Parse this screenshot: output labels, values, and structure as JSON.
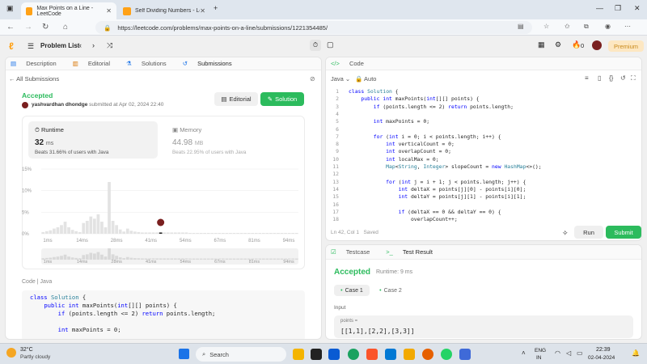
{
  "browser": {
    "tabs": [
      {
        "label": "Max Points on a Line - LeetCode"
      },
      {
        "label": "Self Dividing Numbers - LeetCo"
      }
    ],
    "url": "https://leetcode.com/problems/max-points-on-a-line/submissions/1221354485/"
  },
  "lc_nav": {
    "problem_list": "Problem List",
    "streak": "0",
    "premium": "Premium"
  },
  "left": {
    "tabs": [
      "Description",
      "Editorial",
      "Solutions",
      "Submissions"
    ],
    "all_submissions": "All Submissions",
    "status": "Accepted",
    "author": "yashvardhan dhondge",
    "submitted": "submitted at Apr 02, 2024 22:40",
    "editorial_btn": "Editorial",
    "solution_btn": "Solution",
    "runtime": {
      "label": "Runtime",
      "value": "32",
      "unit": "ms",
      "beats": "Beats 31.66% of users with Java"
    },
    "memory": {
      "label": "Memory",
      "value": "44.98",
      "unit": "MB",
      "beats": "Beats 22.95% of users with Java"
    },
    "code_label": "Code",
    "lang_label": "Java",
    "code_lines": [
      "class Solution {",
      "    public int maxPoints(int[][] points) {",
      "        if (points.length <= 2) return points.length;",
      "",
      "        int maxPoints = 0;"
    ]
  },
  "chart_data": {
    "type": "bar",
    "ylabels": [
      "15%",
      "10%",
      "5%",
      "0%"
    ],
    "xlabels": [
      "1ms",
      "14ms",
      "28ms",
      "41ms",
      "54ms",
      "67ms",
      "81ms",
      "94ms"
    ],
    "mini_xlabels": [
      "1ms",
      "14ms",
      "28ms",
      "41ms",
      "54ms",
      "67ms",
      "81ms",
      "94ms"
    ],
    "values": [
      0.4,
      0.6,
      0.8,
      1.2,
      1.5,
      2.0,
      2.8,
      1.5,
      0.9,
      0.6,
      0.4,
      2.5,
      3.0,
      4.0,
      3.5,
      4.5,
      2.8,
      1.5,
      12.0,
      3.0,
      2.0,
      1.0,
      0.5,
      1.2,
      0.7,
      0.5,
      0.4,
      0.3,
      0.3,
      0.3,
      0.3,
      0.3,
      0.3,
      0.3,
      0.3,
      0.3,
      0.3,
      0.3,
      0.3,
      0.3,
      0.2,
      0.2,
      0.2,
      0.2,
      0.2,
      0.2,
      0.2,
      0.2,
      0.2,
      0.2,
      0.2,
      0.2,
      0.2,
      0.2,
      0.2,
      0.2,
      0.2,
      0.2,
      0.2,
      0.2,
      0.2,
      0.2,
      0.2,
      0.2,
      0.2,
      0.2,
      0.2,
      0.2,
      0.2,
      0.2
    ],
    "highlight_index": 32,
    "ylim": [
      0,
      15
    ]
  },
  "editor": {
    "title": "Code",
    "language": "Java",
    "auto": "Auto",
    "lines": [
      "class Solution {",
      "    public int maxPoints(int[][] points) {",
      "        if (points.length <= 2) return points.length;",
      "",
      "        int maxPoints = 0;",
      "",
      "        for (int i = 0; i < points.length; i++) {",
      "            int verticalCount = 0;",
      "            int overlapCount = 0;",
      "            int localMax = 0;",
      "            Map<String, Integer> slopeCount = new HashMap<>();",
      "",
      "            for (int j = i + 1; j < points.length; j++) {",
      "                int deltaX = points[j][0] - points[i][0];",
      "                int deltaY = points[j][1] - points[i][1];",
      "",
      "                if (deltaX == 0 && deltaY == 0) {",
      "                    overlapCount++;"
    ],
    "status": "Ln 42, Col 1   Saved",
    "run": "Run",
    "submit": "Submit"
  },
  "result": {
    "tabs": [
      "Testcase",
      "Test Result"
    ],
    "status": "Accepted",
    "runtime": "Runtime: 9 ms",
    "cases": [
      "Case 1",
      "Case 2"
    ],
    "input_label": "Input",
    "var": "points =",
    "value": "[[1,1],[2,2],[3,3]]"
  },
  "taskbar": {
    "temp": "32°C",
    "weather": "Partly cloudy",
    "search": "Search",
    "lang1": "ENG",
    "lang2": "IN",
    "time": "22:39",
    "date": "02-04-2024"
  }
}
